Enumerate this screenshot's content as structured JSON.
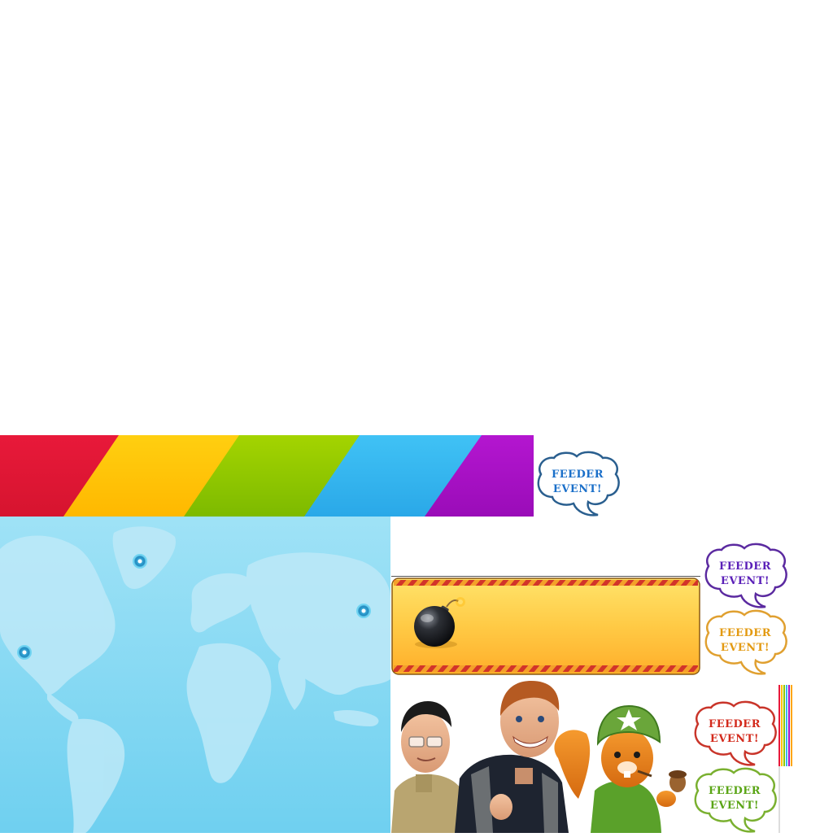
{
  "bubbles": [
    {
      "line1": "FEEDER",
      "line2": "EVENT!",
      "color": "#1a6fc9",
      "border": "#2a5f8f"
    },
    {
      "line1": "FEEDER",
      "line2": "EVENT!",
      "color": "#5a1fb8",
      "border": "#5b2aa0"
    },
    {
      "line1": "FEEDER",
      "line2": "EVENT!",
      "color": "#e39a12",
      "border": "#e0a030"
    },
    {
      "line1": "FEEDER",
      "line2": "EVENT!",
      "color": "#d32a1c",
      "border": "#c9352a"
    },
    {
      "line1": "FEEDER",
      "line2": "EVENT!",
      "color": "#5aa516",
      "border": "#7ab030"
    }
  ],
  "colors": {
    "rainbow": [
      "#e8193a",
      "#ffc400",
      "#8fc900",
      "#36b6ef",
      "#a710c4"
    ],
    "map_sky": "#8fdcf3",
    "map_land": "#b9e9f7",
    "banner_fill": "#ffc844",
    "hazard_red": "#d2342a"
  }
}
